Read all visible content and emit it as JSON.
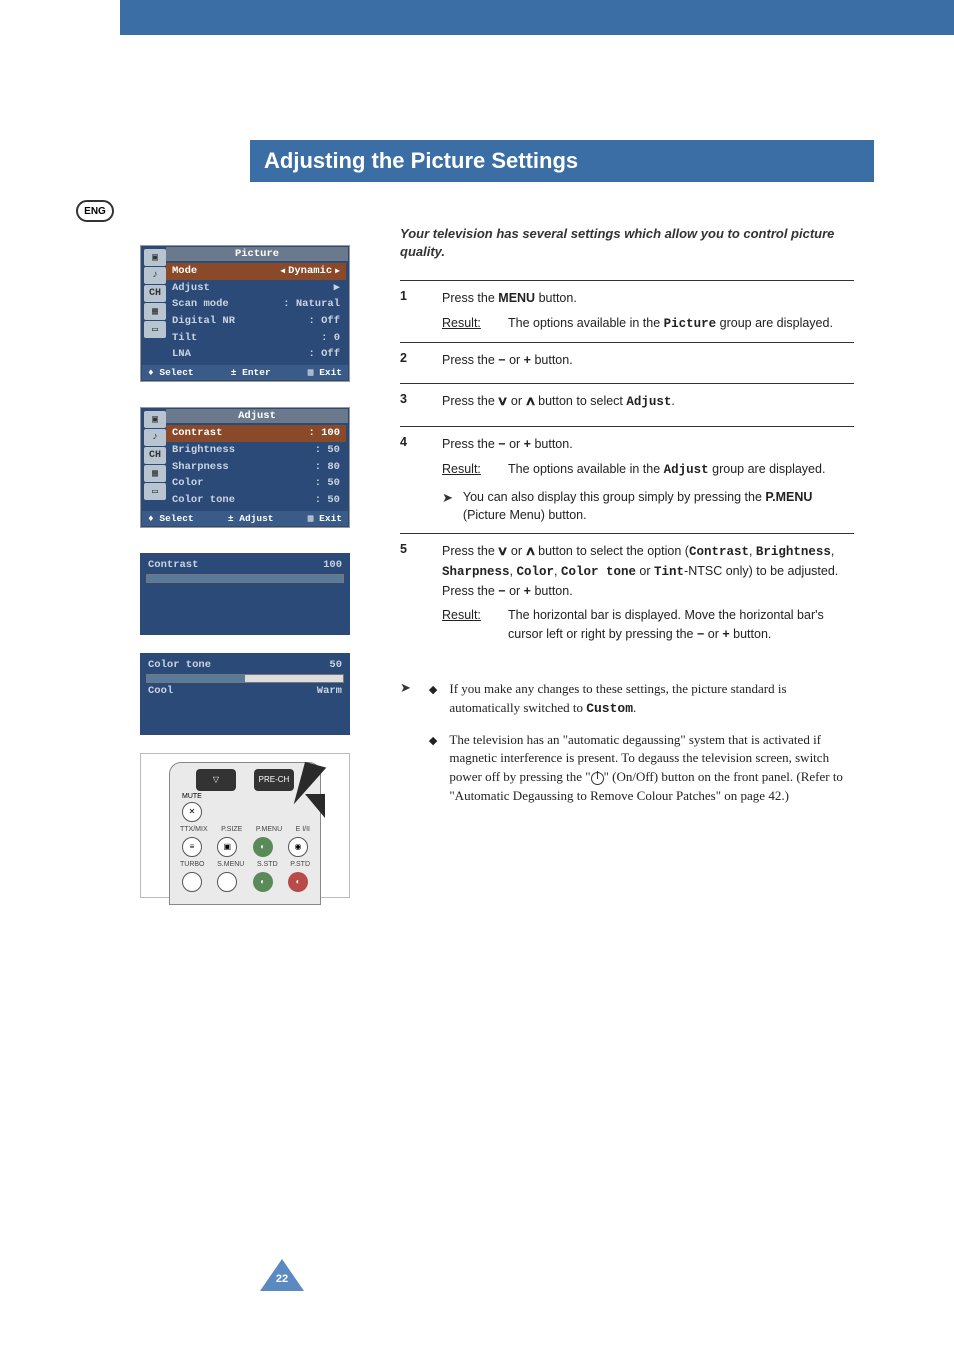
{
  "page": {
    "title": "Adjusting the Picture Settings",
    "lang_badge": "ENG",
    "page_number": "22"
  },
  "osd_picture": {
    "title": "Picture",
    "rows": {
      "mode_label": "Mode",
      "mode_value": "Dynamic",
      "adjust_label": "Adjust",
      "scan_label": "Scan mode",
      "scan_value": ": Natural",
      "nr_label": "Digital NR",
      "nr_value": ": Off",
      "tilt_label": "Tilt",
      "tilt_value": ":  0",
      "lna_label": "LNA",
      "lna_value": ": Off"
    },
    "footer": {
      "select": "Select",
      "enter": "Enter",
      "exit": "Exit"
    }
  },
  "osd_adjust": {
    "title": "Adjust",
    "rows": {
      "contrast_label": "Contrast",
      "contrast_value": ": 100",
      "brightness_label": "Brightness",
      "brightness_value": ":  50",
      "sharpness_label": "Sharpness",
      "sharpness_value": ":  80",
      "color_label": "Color",
      "color_value": ":  50",
      "colortone_label": "Color tone",
      "colortone_value": ":  50"
    },
    "footer": {
      "select": "Select",
      "adjust": "Adjust",
      "exit": "Exit"
    }
  },
  "bar_contrast": {
    "label": "Contrast",
    "value": "100"
  },
  "bar_colortone": {
    "label": "Color tone",
    "value": "50",
    "left": "Cool",
    "right": "Warm"
  },
  "chart_data": {
    "type": "bar",
    "series": [
      {
        "name": "Contrast",
        "value": 100,
        "range": [
          0,
          100
        ]
      },
      {
        "name": "Color tone",
        "value": 50,
        "range": [
          0,
          100
        ],
        "end_labels": [
          "Cool",
          "Warm"
        ]
      }
    ]
  },
  "remote": {
    "mute": "MUTE",
    "pre_ch": "PRE-CH",
    "row1": {
      "a": "TTX/MIX",
      "b": "P.SIZE",
      "c": "P.MENU",
      "d": "E I/II"
    },
    "row2": {
      "a": "TURBO",
      "b": "S.MENU",
      "c": "S.STD",
      "d": "P.STD"
    }
  },
  "intro": "Your television has several settings which allow you to control picture quality.",
  "steps": {
    "s1": {
      "num": "1",
      "line1a": "Press the ",
      "line1b": "MENU",
      "line1c": " button.",
      "result_label": "Result:",
      "result_a": "The options available in the ",
      "result_b": "Picture",
      "result_c": " group are displayed."
    },
    "s2": {
      "num": "2",
      "line_a": "Press the ",
      "line_b": "−",
      "line_c": " or ",
      "line_d": "+",
      "line_e": " button."
    },
    "s3": {
      "num": "3",
      "line_a": "Press the ",
      "line_b": " or ",
      "line_c": " button to select ",
      "line_d": "Adjust",
      "line_e": "."
    },
    "s4": {
      "num": "4",
      "line_a": "Press the ",
      "line_b": "−",
      "line_c": " or ",
      "line_d": "+",
      "line_e": " button.",
      "result_label": "Result:",
      "result_a": "The options available in the ",
      "result_b": "Adjust",
      "result_c": " group are displayed.",
      "note_a": "You can also display this group simply by pressing the ",
      "note_b": "P.MENU",
      "note_c": " (Picture Menu) button."
    },
    "s5": {
      "num": "5",
      "line_a": "Press the ",
      "line_b": " or ",
      "line_c": " button to select the option (",
      "opt1": "Contrast",
      "sep": ", ",
      "opt2": "Brightness",
      "opt3": "Sharpness",
      "opt4": "Color",
      "opt5": "Color tone",
      "or": " or ",
      "opt6": "Tint",
      "ntsc": "-NTSC only) to be adjusted. Press the ",
      "m": "−",
      "or2": " or ",
      "p": "+",
      "end": " button.",
      "result_label": "Result:",
      "result_a": "The horizontal bar is displayed. Move the horizontal bar's cursor left or right by pressing the ",
      "rm": "−",
      "ror": " or ",
      "rp": "+",
      "rend": " button."
    }
  },
  "notes": {
    "n1_a": "If you make any changes to these settings, the picture standard is automatically switched to ",
    "n1_b": "Custom",
    "n1_c": ".",
    "n2": "The television has an \"automatic degaussing\" system that is activated if magnetic interference is present. To degauss the television screen, switch power off by pressing the \"",
    "n2_b": "\" (On/Off) button on the front panel. (Refer to \"Automatic Degaussing to Remove Colour Patches\" on page 42.)"
  }
}
